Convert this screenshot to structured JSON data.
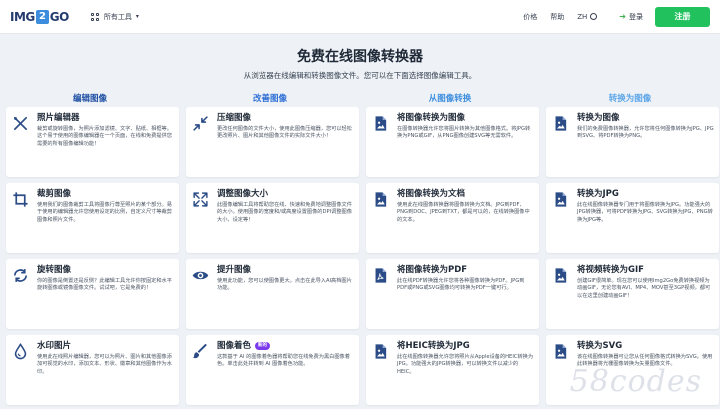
{
  "header": {
    "logo_a": "IMG",
    "logo_b": "2",
    "logo_c": "GO",
    "all_tools": "所有工具",
    "pricing": "价格",
    "help": "帮助",
    "lang": "ZH",
    "login": "登录",
    "signup": "注册"
  },
  "hero": {
    "title": "免费在线图像转换器",
    "subtitle": "从浏览器在线编辑和转换图像文件。您可以在下面选择图像编辑工具。"
  },
  "categories": [
    {
      "label": "编辑图像",
      "color": "#1f4fa3"
    },
    {
      "label": "改善图像",
      "color": "#2e6fd6"
    },
    {
      "label": "从图像转换",
      "color": "#3c8dde"
    },
    {
      "label": "转换为图像",
      "color": "#5ba5e8"
    }
  ],
  "cards": [
    {
      "icon": "crop-tools-icon",
      "title": "照片编辑器",
      "desc": "裁剪或旋转图像，为照片添加滤镜、文字、贴纸、相框等。这个易于使用的图像编辑器在一个页面，在线和免费提供您需要的所有图像编辑功能！"
    },
    {
      "icon": "compress-icon",
      "title": "压缩图像",
      "desc": "更改任何图像的文件大小，使用此图像压缩器，您可以轻松更改照片、图片和其他图像文件的实际文件大小！"
    },
    {
      "icon": "image-file-icon",
      "title": "将图像转换为图像",
      "desc": "在图像转换器允许您将图片转换为其他图像格式。将JPG转换为PNG或GIF，从PNG图像创建SVG等无需软件。"
    },
    {
      "icon": "image-file-icon",
      "title": "转换为图像",
      "desc": "我们的免费图像转换器，允许您将任何图像转换为JPG、JPG到SVG、将PDF转换为PNG。"
    },
    {
      "icon": "crop-icon",
      "title": "裁剪图像",
      "desc": "使用我们的图像裁剪工具将图像行尊至照片的某个部分。易于使用的编辑器允许您使用设定的比例，自定义尺寸等裁剪图像和照片文件。"
    },
    {
      "icon": "resize-icon",
      "title": "调整图像大小",
      "desc": "此图像编辑工具将帮助您在线、快速和免费地调整图像文件的大小。使用图像的宽度和/或高度设置图像的DPI调整图像大小、设定等！"
    },
    {
      "icon": "image-file-icon",
      "title": "将图像转换为文档",
      "desc": "使用此在线图像转换器将图像转换为文档。JPG到PDF、PNG到DOC、JPEG到TXT，都是可以的，在线转换图像中的文本。"
    },
    {
      "icon": "image-file-icon",
      "title": "转换为JPG",
      "desc": "此在线图像转换器专门用于将图像转换为JPG。功能强大的JPG转换器，可将PDF转换为JPG、SVG转换为JPG、PNG转换为JPG等。"
    },
    {
      "icon": "rotate-icon",
      "title": "旋转图像",
      "desc": "你的图像是倒置还是反侧？此编辑工具允许你按固定和水平旋转图像或镜像图像文件。试试吧，它是免费的！"
    },
    {
      "icon": "eye-icon",
      "title": "提升图像",
      "desc": "使用此功能，您可以使图像更大。点击在此导入AI高档图片功能。"
    },
    {
      "icon": "pdf-file-icon",
      "title": "将图像转换为PDF",
      "desc": "此在线PDF转换器允许您将各种图像转换为PDF。JPG到PDF或PNG或SVG图像均可转换为PDF一键可行。"
    },
    {
      "icon": "image-file-icon",
      "title": "将视频转换为GIF",
      "desc": "创建GIF很简单。现在您可以使用Img2Go免费转换视频为动画GIF，无论您有AVI、MP4、MOV甚至3GP视频，都可以在这里创建动画GIF！"
    },
    {
      "icon": "drop-icon",
      "title": "水印图片",
      "desc": "使用此在线照片编辑器，您可以为照片、图片和其他图像添加可视觉的水印，添加文本、形状、徽章和其他图像作为水印。"
    },
    {
      "icon": "brush-icon",
      "title": "图像着色",
      "badge": "新的",
      "desc": "这款基于 AI 的图像着色器将帮助您在线免费为黑白图像着色。单击此处并转到 AI 图像着色功能。"
    },
    {
      "icon": "image-file-icon",
      "title": "将HEIC转换为JPG",
      "desc": "此在线图像转换器允许您将照片从Apple设备的HEIC转换为JPG。功能强大的JPG转换器，可以转换文件以减少的HEIC。"
    },
    {
      "icon": "image-file-icon",
      "title": "转换为SVG",
      "desc": "该在线图像转换器可让您从任何图像格式转换为SVG。使用此转换器将光栅图像转换为矢量图像文件。"
    }
  ],
  "colors": {
    "icon": "#2b4c86",
    "signup": "#21c25e",
    "background": "#eef2f6"
  },
  "watermark": "58codes"
}
